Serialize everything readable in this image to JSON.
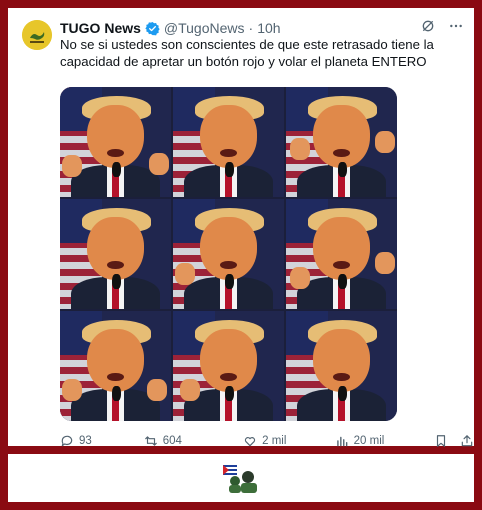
{
  "post": {
    "author_name": "TUGO News",
    "handle": "@TugoNews",
    "separator": "·",
    "time": "10h",
    "text": "No se si ustedes son conscientes de que este retrasado tiene la capacidad de apretar un botón rojo y volar el planeta ENTERO",
    "avatar_icon": "snake-flag-avatar",
    "verified_color": "#1d9bf0",
    "media": {
      "frames": 9,
      "layout": "3x3 grid"
    }
  },
  "actions": {
    "replies": "93",
    "reposts": "604",
    "likes": "2 mil",
    "views": "20 mil"
  },
  "colors": {
    "background": "#8a0a12",
    "card": "#ffffff",
    "text": "#0f1419",
    "muted": "#536471"
  },
  "footer": {
    "emoji": "flag-and-figures-icon"
  }
}
